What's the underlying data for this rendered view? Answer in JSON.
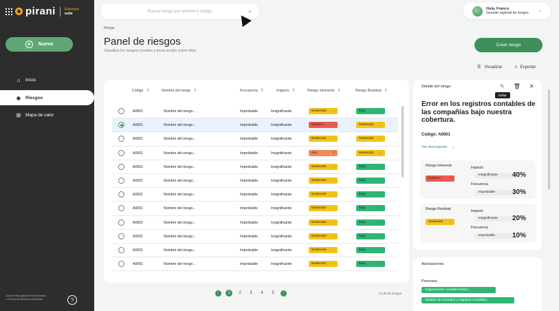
{
  "app": {
    "brand": "pirani",
    "suite_line1": "Riskment",
    "suite_line2": "suite"
  },
  "sidebar": {
    "new_label": "Nuevo",
    "items": [
      {
        "label": "Inicio",
        "icon": "home-icon",
        "glyph": "⌂"
      },
      {
        "label": "Riesgos",
        "icon": "risk-icon",
        "glyph": "◈"
      },
      {
        "label": "Mapa de calor",
        "icon": "heatmap-icon",
        "glyph": "⊞"
      }
    ],
    "footer": "Cómo te está gustando Pirani Versión 1.0 Todos los derechos reservados",
    "help": "?"
  },
  "search": {
    "placeholder": "Buscar riesgo por nombre o código"
  },
  "user": {
    "greeting": "Hola, Franco",
    "email": "Gerente regional de riesgos"
  },
  "header": {
    "breadcrumb": "Riesgo",
    "title": "Panel de riesgos",
    "subtitle": "Visualiza los riesgos creados y toma acción sobre ellos",
    "create": "Crear riesgo"
  },
  "toolbar": {
    "view": "Visualizar",
    "export": "Exportar"
  },
  "table": {
    "columns": [
      "Código",
      "Nombre del riesgo",
      "Frecuencia",
      "Impacto",
      "Riesgo Inherente",
      "Riesgo Residual"
    ],
    "rows": [
      {
        "code": "A0001",
        "name": "Nombre del riesgo...",
        "freq": "Improbable",
        "impact": "Insignificante",
        "inherent": "Moderado",
        "inh_arrow": "→",
        "residual": "Bajo",
        "res_arrow": "↓",
        "selected": false
      },
      {
        "code": "A0001",
        "name": "Nombre del riesgo...",
        "freq": "Improbable",
        "impact": "Insignificante",
        "inherent": "Extremo",
        "inh_arrow": "↑",
        "residual": "Moderado",
        "res_arrow": "→",
        "selected": true
      },
      {
        "code": "A0001",
        "name": "Nombre del riesgo...",
        "freq": "Improbable",
        "impact": "Insignificante",
        "inherent": "Moderado",
        "inh_arrow": "→",
        "residual": "Moderado",
        "res_arrow": "→",
        "selected": false
      },
      {
        "code": "A0001",
        "name": "Nombre del riesgo...",
        "freq": "Improbable",
        "impact": "Insignificante",
        "inherent": "Alto",
        "inh_arrow": "↗",
        "residual": "Moderado",
        "res_arrow": "→",
        "selected": false
      },
      {
        "code": "A0001",
        "name": "Nombre del riesgo...",
        "freq": "Improbable",
        "impact": "Insignificante",
        "inherent": "Moderado",
        "inh_arrow": "→",
        "residual": "Bajo",
        "res_arrow": "↓",
        "selected": false
      },
      {
        "code": "A0001",
        "name": "Nombre del riesgo...",
        "freq": "Improbable",
        "impact": "Insignificante",
        "inherent": "Moderado",
        "inh_arrow": "→",
        "residual": "Bajo",
        "res_arrow": "↓",
        "selected": false
      },
      {
        "code": "A0001",
        "name": "Nombre del riesgo...",
        "freq": "Improbable",
        "impact": "Insignificante",
        "inherent": "Moderado",
        "inh_arrow": "→",
        "residual": "Bajo",
        "res_arrow": "↓",
        "selected": false
      },
      {
        "code": "A0001",
        "name": "Nombre del riesgo...",
        "freq": "Improbable",
        "impact": "Insignificante",
        "inherent": "Moderado",
        "inh_arrow": "→",
        "residual": "Bajo",
        "res_arrow": "↓",
        "selected": false
      },
      {
        "code": "A0001",
        "name": "Nombre del riesgo...",
        "freq": "Improbable",
        "impact": "Insignificante",
        "inherent": "Moderado",
        "inh_arrow": "→",
        "residual": "Bajo",
        "res_arrow": "↓",
        "selected": false
      },
      {
        "code": "A0001",
        "name": "Nombre del riesgo...",
        "freq": "Improbable",
        "impact": "Insignificante",
        "inherent": "Moderado",
        "inh_arrow": "→",
        "residual": "Bajo",
        "res_arrow": "↓",
        "selected": false
      },
      {
        "code": "A0001",
        "name": "Nombre del riesgo...",
        "freq": "Improbable",
        "impact": "Insignificante",
        "inherent": "Moderado",
        "inh_arrow": "→",
        "residual": "Bajo",
        "res_arrow": "↓",
        "selected": false
      },
      {
        "code": "A0001",
        "name": "Nombre del riesgo...",
        "freq": "Improbable",
        "impact": "Insignificante",
        "inherent": "Moderado",
        "inh_arrow": "→",
        "residual": "Bajo",
        "res_arrow": "↓",
        "selected": false
      }
    ]
  },
  "pagination": {
    "pages": [
      "1",
      "2",
      "3",
      "4",
      "5"
    ],
    "current": "1",
    "summary": "12 de 50 riesgos"
  },
  "detail": {
    "title": "Detalle del riesgo",
    "edit_tooltip": "Editar",
    "heading": "Error en los registros contables de las compañías bajo nuestra cobertura.",
    "code": "Código: A0001",
    "more": "Ver descripción",
    "inherent": {
      "label": "Riesgo Inherente",
      "badge": "Extremo",
      "arrow": "↑",
      "impact_label": "Impacto",
      "impact": "Insignificante",
      "impact_pct": "40%",
      "freq_label": "Frecuencia",
      "freq": "Improbable",
      "freq_pct": "30%"
    },
    "residual": {
      "label": "Riesgo Residual",
      "badge": "Moderado",
      "arrow": "→",
      "impact_label": "Impacto",
      "impact": "Insignificante",
      "impact_pct": "20%",
      "freq_label": "Frecuencia",
      "freq": "Improbable",
      "freq_pct": "10%"
    }
  },
  "associations": {
    "title": "Asociaciones",
    "processes_label": "Procesos",
    "processes": [
      "Organización contable financi...",
      "Gestión de recaudos y registros contables..."
    ]
  },
  "colors": {
    "primary": "#3f8f5a",
    "sidebar": "#2d2d2d",
    "moderado": "#f2c318",
    "extremo": "#ec5a4f",
    "alto": "#ef8a59",
    "bajo": "#2fb574"
  }
}
